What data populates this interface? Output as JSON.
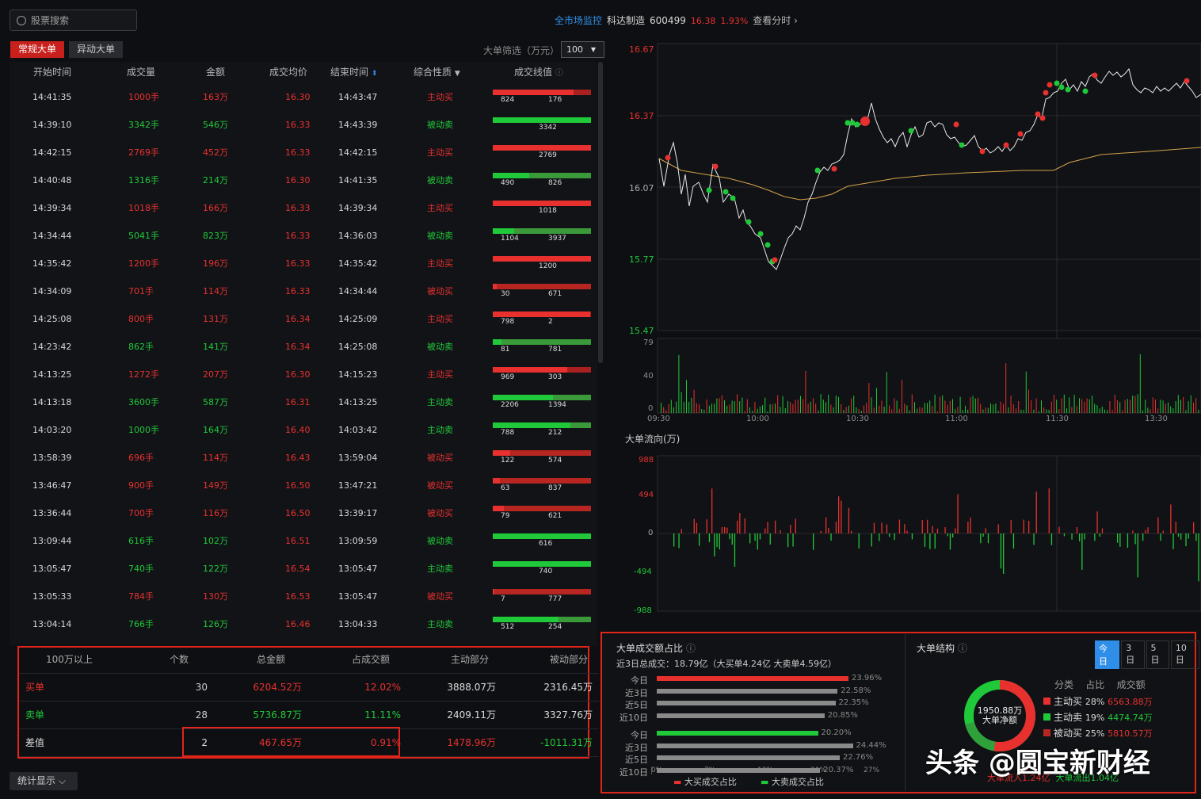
{
  "search": {
    "placeholder": "股票搜索"
  },
  "header": {
    "monitor": "全市场监控",
    "name": "科达制造",
    "code": "600499",
    "price": "16.38",
    "change": "1.93%",
    "view": "查看分时 ›"
  },
  "tabs": {
    "regular": "常规大单",
    "abnormal": "异动大单"
  },
  "filter": {
    "label": "大单筛选（万元）",
    "value": "100"
  },
  "columns": [
    "开始时间",
    "成交量",
    "金额",
    "成交均价",
    "结束时间",
    "综合性质",
    "成交线值"
  ],
  "rows": [
    [
      "14:41:35",
      "1000手",
      "163万",
      "16.30",
      "14:43:47",
      "主动买",
      "824",
      "176",
      "r",
      82
    ],
    [
      "14:39:10",
      "3342手",
      "546万",
      "16.33",
      "14:43:39",
      "被动卖",
      "3342",
      "",
      "g",
      100
    ],
    [
      "14:42:15",
      "2769手",
      "452万",
      "16.33",
      "14:42:15",
      "主动买",
      "2769",
      "",
      "r",
      100
    ],
    [
      "14:40:48",
      "1316手",
      "214万",
      "16.30",
      "14:41:35",
      "被动卖",
      "490",
      "826",
      "gg",
      37
    ],
    [
      "14:39:34",
      "1018手",
      "166万",
      "16.33",
      "14:39:34",
      "主动买",
      "1018",
      "",
      "r",
      100
    ],
    [
      "14:34:44",
      "5041手",
      "823万",
      "16.33",
      "14:36:03",
      "被动卖",
      "1104",
      "3937",
      "gg",
      22
    ],
    [
      "14:35:42",
      "1200手",
      "196万",
      "16.33",
      "14:35:42",
      "主动买",
      "1200",
      "",
      "r",
      100
    ],
    [
      "14:34:09",
      "701手",
      "114万",
      "16.33",
      "14:34:44",
      "被动买",
      "30",
      "671",
      "rr",
      4
    ],
    [
      "14:25:08",
      "800手",
      "131万",
      "16.34",
      "14:25:09",
      "主动买",
      "798",
      "2",
      "r",
      99
    ],
    [
      "14:23:42",
      "862手",
      "141万",
      "16.34",
      "14:25:08",
      "被动卖",
      "81",
      "781",
      "gg",
      9
    ],
    [
      "14:13:25",
      "1272手",
      "207万",
      "16.30",
      "14:15:23",
      "主动买",
      "969",
      "303",
      "r",
      76
    ],
    [
      "14:13:18",
      "3600手",
      "587万",
      "16.31",
      "14:13:25",
      "主动卖",
      "2206",
      "1394",
      "gg",
      61
    ],
    [
      "14:03:20",
      "1000手",
      "164万",
      "16.40",
      "14:03:42",
      "主动卖",
      "788",
      "212",
      "gg",
      79
    ],
    [
      "13:58:39",
      "696手",
      "114万",
      "16.43",
      "13:59:04",
      "被动买",
      "122",
      "574",
      "rr",
      18
    ],
    [
      "13:46:47",
      "900手",
      "149万",
      "16.50",
      "13:47:21",
      "被动买",
      "63",
      "837",
      "rr",
      7
    ],
    [
      "13:36:44",
      "700手",
      "116万",
      "16.50",
      "13:39:17",
      "被动买",
      "79",
      "621",
      "rr",
      11
    ],
    [
      "13:09:44",
      "616手",
      "102万",
      "16.51",
      "13:09:59",
      "被动卖",
      "616",
      "",
      "g",
      100
    ],
    [
      "13:05:47",
      "740手",
      "122万",
      "16.54",
      "13:05:47",
      "主动卖",
      "740",
      "",
      "g",
      100
    ],
    [
      "13:05:33",
      "784手",
      "130万",
      "16.53",
      "13:05:47",
      "被动买",
      "7",
      "777",
      "rr",
      2
    ],
    [
      "13:04:14",
      "766手",
      "126万",
      "16.46",
      "13:04:33",
      "主动卖",
      "512",
      "254",
      "gg",
      67
    ]
  ],
  "summary": {
    "headers": [
      "100万以上",
      "个数",
      "总金额",
      "占成交额",
      "主动部分",
      "被动部分"
    ],
    "rows": [
      [
        "买单",
        "30",
        "6204.52万",
        "12.02%",
        "3888.07万",
        "2316.45万"
      ],
      [
        "卖单",
        "28",
        "5736.87万",
        "11.11%",
        "2409.11万",
        "3327.76万"
      ],
      [
        "差值",
        "2",
        "467.65万",
        "0.91%",
        "1478.96万",
        "-1011.31万"
      ]
    ]
  },
  "stats_btn": "统计显示 ⌵",
  "price_chart": {
    "ylabels": [
      "16.67",
      "16.37",
      "16.07",
      "15.77",
      "15.47"
    ],
    "vol_labels": [
      "79",
      "40",
      "0"
    ],
    "xlabels": [
      "09:30",
      "10:00",
      "10:30",
      "11:00",
      "11:30",
      "13:30"
    ]
  },
  "flow_chart": {
    "title": "大单流向(万)",
    "ylabels": [
      "988",
      "494",
      "0",
      "-494",
      "-988"
    ]
  },
  "ratio_panel": {
    "title": "大单成交额占比",
    "total": "近3日总成交：18.79亿（大买单4.24亿  大卖单4.59亿）",
    "buy": [
      [
        "今日",
        "23.96%",
        88
      ],
      [
        "近3日",
        "22.58%",
        83
      ],
      [
        "近5日",
        "22.35%",
        82
      ],
      [
        "近10日",
        "20.85%",
        77
      ]
    ],
    "sell": [
      [
        "今日",
        "20.20%",
        74
      ],
      [
        "近3日",
        "24.44%",
        90
      ],
      [
        "近5日",
        "22.76%",
        84
      ],
      [
        "近10日",
        "20.37%",
        75
      ]
    ],
    "ticks": [
      "0%",
      "7%",
      "13%",
      "20%",
      "27%"
    ],
    "legend_buy": "大买成交占比",
    "legend_sell": "大卖成交占比"
  },
  "structure": {
    "title": "大单结构",
    "periods": [
      "今日",
      "3日",
      "5日",
      "10日"
    ],
    "net_value": "1950.88万",
    "net_label": "大单净额",
    "headers": [
      "分类",
      "占比",
      "成交额"
    ],
    "items": [
      [
        "主动买",
        "28%",
        "6563.88万"
      ],
      [
        "主动卖",
        "19%",
        "4474.74万"
      ],
      [
        "被动买",
        "25%",
        "5810.57万"
      ]
    ],
    "inflow": "大单流入1.24亿",
    "outflow": "大单流出1.04亿"
  },
  "watermark": "头条 @圆宝新财经",
  "colors": {
    "up": "#e8312f",
    "down": "#20c93a",
    "accent": "#2f8fe8",
    "highlight": "#e1251b"
  }
}
